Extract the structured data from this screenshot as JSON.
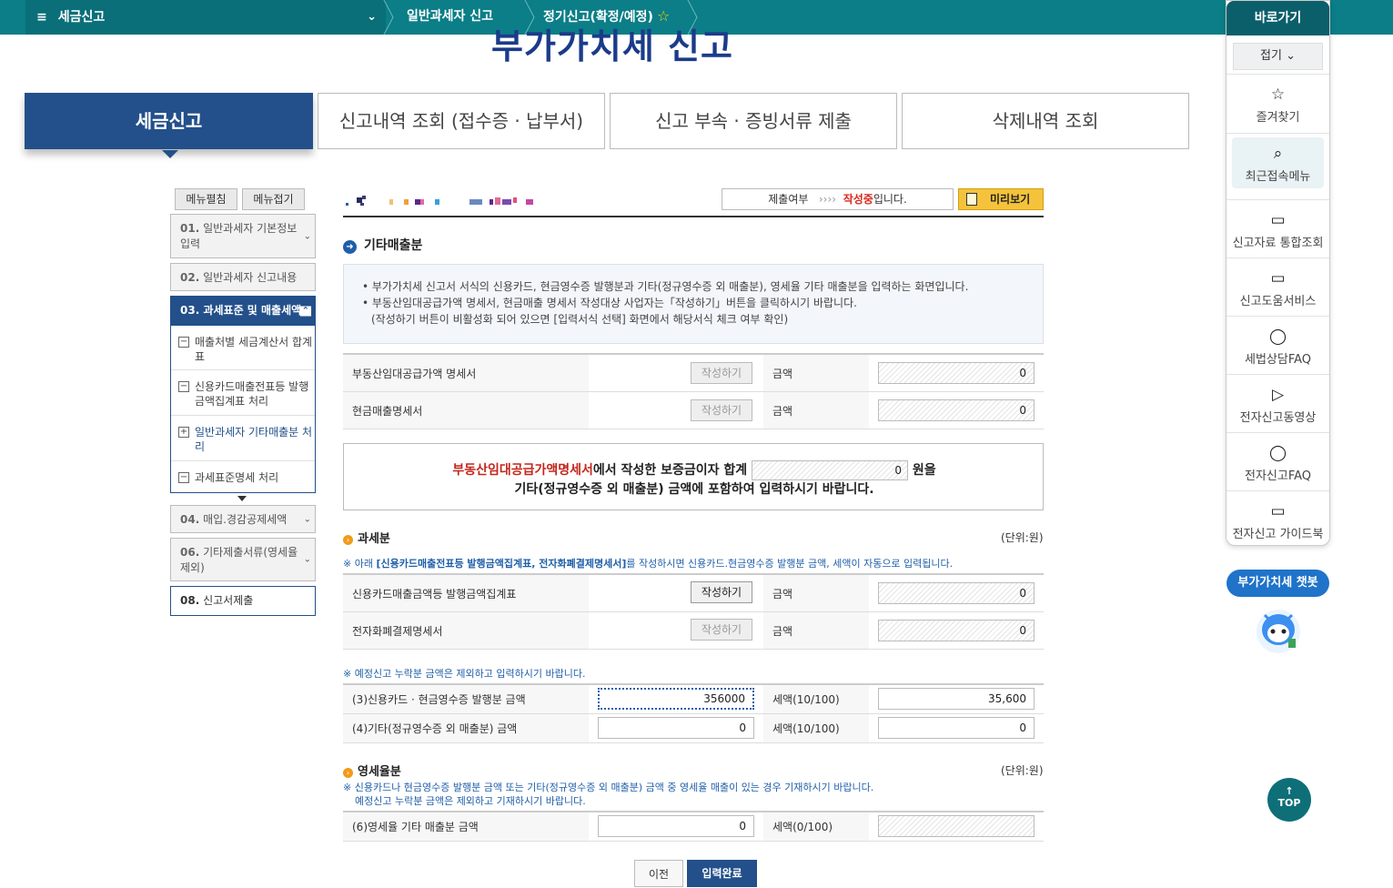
{
  "topbar": {
    "menu_label": "세금신고",
    "crumb1": "일반과세자 신고",
    "crumb2": "정기신고(확정/예정)"
  },
  "page": {
    "title": "부가가치세 신고"
  },
  "tabs": [
    "세금신고",
    "신고내역 조회 (접수증 · 납부서)",
    "신고 부속 · 증빙서류 제출",
    "삭제내역 조회"
  ],
  "sidebar": {
    "edit_label": "메뉴펼침",
    "fold_label": "메뉴접기",
    "items": [
      {
        "num": "01.",
        "label": "일반과세자 기본정보입력"
      },
      {
        "num": "02.",
        "label": "일반과세자 신고내용"
      },
      {
        "num": "03.",
        "label": "과세표준 및 매출세액"
      },
      {
        "num": "04.",
        "label": "매입.경감공제세액"
      },
      {
        "num": "06.",
        "label": "기타제출서류(영세율제외)"
      },
      {
        "num": "08.",
        "label": "신고서제출"
      }
    ],
    "sub": [
      {
        "sign": "−",
        "label": "매출처별 세금계산서 합계표"
      },
      {
        "sign": "−",
        "label": "신용카드매출전표등 발행금액집계표 처리"
      },
      {
        "sign": "+",
        "label": "일반과세자 기타매출분 처리"
      },
      {
        "sign": "−",
        "label": "과세표준명세 처리"
      }
    ]
  },
  "status": {
    "prefix": "제출여부",
    "arrows": "››››",
    "state": "작성중",
    "suffix": "입니다.",
    "preview_label": "미리보기"
  },
  "section_main": {
    "title": "기타매출분"
  },
  "info": {
    "line1": "• 부가가치세 신고서 서식의 신용카드, 현금영수증 발행분과 기타(정규영수증 외 매출분), 영세율 기타 매출분을 입력하는 화면입니다.",
    "line2": "• 부동산임대공급가액 명세서, 현금매출 명세서 작성대상 사업자는「작성하기」버튼을 클릭하시기 바랍니다.",
    "line3": "(작성하기 버튼이 비활성화 되어 있으면 [입력서식 선택] 화면에서 해당서식 체크 여부 확인)"
  },
  "rows_top": [
    {
      "label": "부동산임대공급가액 명세서",
      "btn": "작성하기",
      "amt_label": "금액",
      "value": "0"
    },
    {
      "label": "현금매출명세서",
      "btn": "작성하기",
      "amt_label": "금액",
      "value": "0"
    }
  ],
  "notice": {
    "red": "부동산임대공급가액명세서",
    "mid": "에서 작성한 보증금이자 합계",
    "value": "0",
    "end": "원을",
    "line2": "기타(정규영수증 외 매출분) 금액에 포함하여 입력하시기 바랍니다."
  },
  "tax": {
    "title": "과세분",
    "unit": "(단위:원)",
    "note_pre": "※ 아래 ",
    "note_bold": "[신용카드매출전표등 발행금액집계표, 전자화폐결제명세서]",
    "note_post": "를 작성하시면 신용카드.현금영수증 발행분 금액, 세액이 자동으로 입력됩니다.",
    "rows": [
      {
        "label": "신용카드매출금액등 발행금액집계표",
        "btn": "작성하기",
        "amt_label": "금액",
        "value": "0"
      },
      {
        "label": "전자화폐결제명세서",
        "btn": "작성하기",
        "amt_label": "금액",
        "value": "0"
      }
    ],
    "note2": "※ 예정신고 누락분 금액은 제외하고 입력하시기 바랍니다.",
    "entry": [
      {
        "label": "(3)신용카드 · 현금영수증 발행분 금액",
        "value": "356000",
        "tax_label": "세액(10/100)",
        "tax": "35,600"
      },
      {
        "label": "(4)기타(정규영수증 외 매출분) 금액",
        "value": "0",
        "tax_label": "세액(10/100)",
        "tax": "0"
      }
    ]
  },
  "zero": {
    "title": "영세율분",
    "unit": "(단위:원)",
    "note1": "※ 신용카드나 현금영수증 발행분 금액 또는 기타(정규영수증 외 매출분) 금액 중 영세율 매출이 있는 경우 기재하시기 바랍니다.",
    "note2": "예정신고 누락분 금액은 제외하고 기재하시기 바랍니다.",
    "row": {
      "label": "(6)영세율 기타 매출분 금액",
      "value": "0",
      "tax_label": "세액(0/100)"
    }
  },
  "buttons": {
    "prev": "이전",
    "done": "입력완료"
  },
  "quick": {
    "title": "바로가기",
    "fold": "접기",
    "items": [
      "즐겨찾기",
      "최근접속메뉴",
      "신고자료 통합조회",
      "신고도움서비스",
      "세법상담FAQ",
      "전자신고동영상",
      "전자신고FAQ",
      "전자신고 가이드북"
    ],
    "chatbot": "부가가치세 챗봇",
    "top": "TOP"
  }
}
